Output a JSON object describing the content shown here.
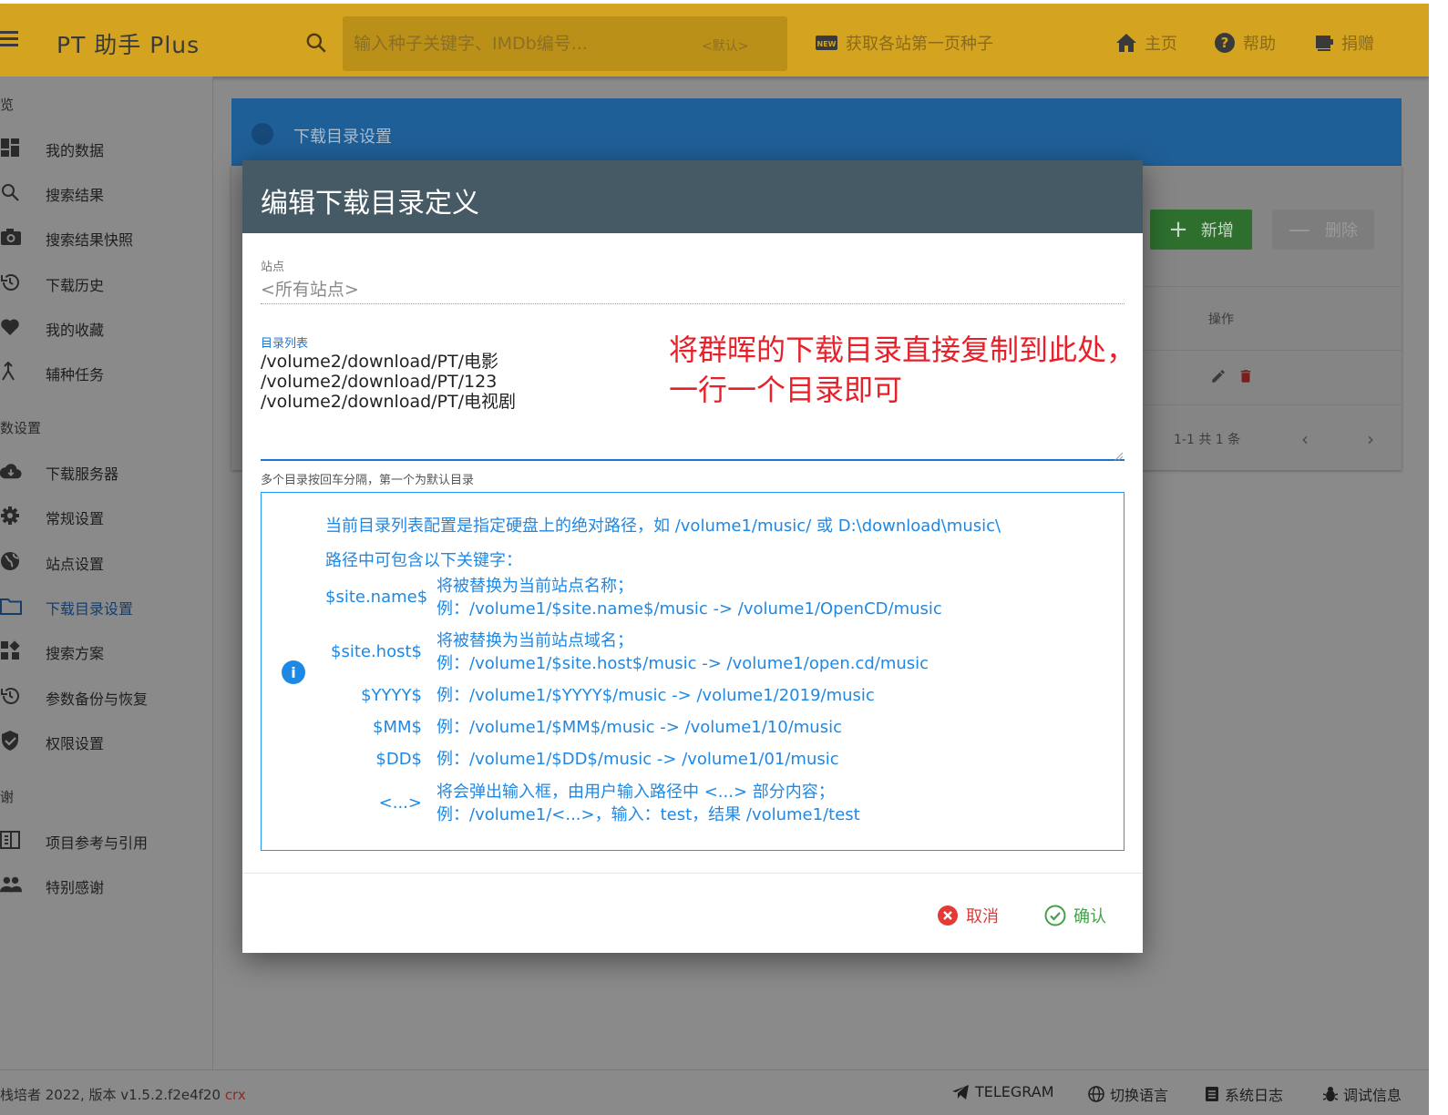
{
  "app": {
    "title": "PT 助手 Plus"
  },
  "search": {
    "placeholder": "输入种子关键字、IMDb编号...",
    "scope": "<默认>"
  },
  "header_actions": [
    {
      "label": "获取各站第一页种子",
      "icon": "new-badge-icon"
    },
    {
      "label": "主页",
      "icon": "home-icon"
    },
    {
      "label": "帮助",
      "icon": "help-icon"
    },
    {
      "label": "捐赠",
      "icon": "donate-icon"
    }
  ],
  "sidebar": {
    "sections": [
      "览",
      "数设置",
      "谢"
    ],
    "items": [
      {
        "label": "我的数据",
        "icon": "dashboard-icon"
      },
      {
        "label": "搜索结果",
        "icon": "search-icon"
      },
      {
        "label": "搜索结果快照",
        "icon": "camera-icon"
      },
      {
        "label": "下载历史",
        "icon": "history-icon"
      },
      {
        "label": "我的收藏",
        "icon": "heart-icon"
      },
      {
        "label": "辅种任务",
        "icon": "merge-icon"
      },
      {
        "label": "下载服务器",
        "icon": "cloud-download-icon"
      },
      {
        "label": "常规设置",
        "icon": "gear-icon"
      },
      {
        "label": "站点设置",
        "icon": "globe-icon"
      },
      {
        "label": "下载目录设置",
        "icon": "folder-icon"
      },
      {
        "label": "搜索方案",
        "icon": "widgets-icon"
      },
      {
        "label": "参数备份与恢复",
        "icon": "restore-icon"
      },
      {
        "label": "权限设置",
        "icon": "shield-icon"
      },
      {
        "label": "项目参考与引用",
        "icon": "reference-icon"
      },
      {
        "label": "特别感谢",
        "icon": "people-icon"
      }
    ]
  },
  "background": {
    "banner_title": "下载目录设置",
    "add_button": "新增",
    "delete_button": "删除",
    "column_action": "操作",
    "pagination": "1-1 共 1 条"
  },
  "footer": {
    "version": "栈培者 2022, 版本 v1.5.2.f2e4f20",
    "version_tag": "crx",
    "links": [
      {
        "label": "TELEGRAM",
        "icon": "telegram-icon"
      },
      {
        "label": "切换语言",
        "icon": "language-icon"
      },
      {
        "label": "系统日志",
        "icon": "log-icon"
      },
      {
        "label": "调试信息",
        "icon": "bug-icon"
      }
    ]
  },
  "dialog": {
    "title": "编辑下载目录定义",
    "site_label": "站点",
    "site_value": "<所有站点>",
    "dir_label": "目录列表",
    "dir_lines": [
      "/volume2/download/PT/电影",
      "/volume2/download/PT/123",
      "/volume2/download/PT/电视剧"
    ],
    "hint": "多个目录按回车分隔，第一个为默认目录",
    "annotation_lines": [
      "将群晖的下载目录直接复制到此处，",
      "一行一个目录即可"
    ],
    "info_intro": "当前目录列表配置是指定硬盘上的绝对路径，如 /volume1/music/ 或 D:\\download\\music\\",
    "info_keywords_title": "路径中可包含以下关键字：",
    "keywords": [
      {
        "key": "$site.name$",
        "desc": "将被替换为当前站点名称；",
        "example": "例：/volume1/$site.name$/music -> /volume1/OpenCD/music"
      },
      {
        "key": "$site.host$",
        "desc": "将被替换为当前站点域名；",
        "example": "例：/volume1/$site.host$/music -> /volume1/open.cd/music"
      },
      {
        "key": "$YYYY$",
        "desc": "",
        "example": "例：/volume1/$YYYY$/music -> /volume1/2019/music"
      },
      {
        "key": "$MM$",
        "desc": "",
        "example": "例：/volume1/$MM$/music -> /volume1/10/music"
      },
      {
        "key": "$DD$",
        "desc": "",
        "example": "例：/volume1/$DD$/music -> /volume1/01/music"
      },
      {
        "key": "<...>",
        "desc": "将会弹出输入框，由用户输入路径中 <...> 部分内容；",
        "example": "例：/volume1/<...>，输入：test，结果 /volume1/test"
      }
    ],
    "cancel": "取消",
    "confirm": "确认"
  }
}
